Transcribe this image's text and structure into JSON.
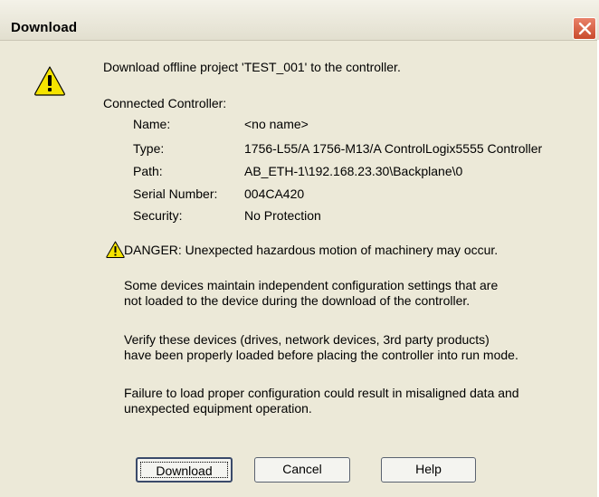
{
  "window": {
    "title": "Download"
  },
  "message": {
    "headline": "Download offline project 'TEST_001' to the controller.",
    "connected_label": "Connected Controller:",
    "fields": [
      {
        "label": "Name:",
        "value": "<no name>"
      },
      {
        "label": "Type:",
        "value": "1756-L55/A 1756-M13/A ControlLogix5555 Controller"
      },
      {
        "label": "Path:",
        "value": "AB_ETH-1\\192.168.23.30\\Backplane\\0"
      },
      {
        "label": "Serial Number:",
        "value": "004CA420"
      },
      {
        "label": "Security:",
        "value": "No Protection"
      }
    ]
  },
  "danger": {
    "heading": "DANGER: Unexpected hazardous motion of machinery may occur.",
    "paragraph1": [
      "Some devices maintain independent configuration settings that are",
      "not loaded to the device during the download of the controller."
    ],
    "paragraph2": [
      "Verify these devices (drives, network devices, 3rd party products)",
      "have been properly loaded before placing the controller into run mode."
    ],
    "paragraph3": [
      "Failure to load proper configuration could result in misaligned data and",
      "unexpected equipment operation."
    ]
  },
  "buttons": {
    "download": "Download",
    "cancel": "Cancel",
    "help": "Help"
  },
  "icons": {
    "close": "close-icon",
    "warning_large": "warning-icon",
    "warning_small": "warning-small-icon"
  },
  "colors": {
    "dialog_bg": "#ece9d8",
    "close_red": "#d35a3c",
    "warning_yellow": "#f5e400"
  }
}
